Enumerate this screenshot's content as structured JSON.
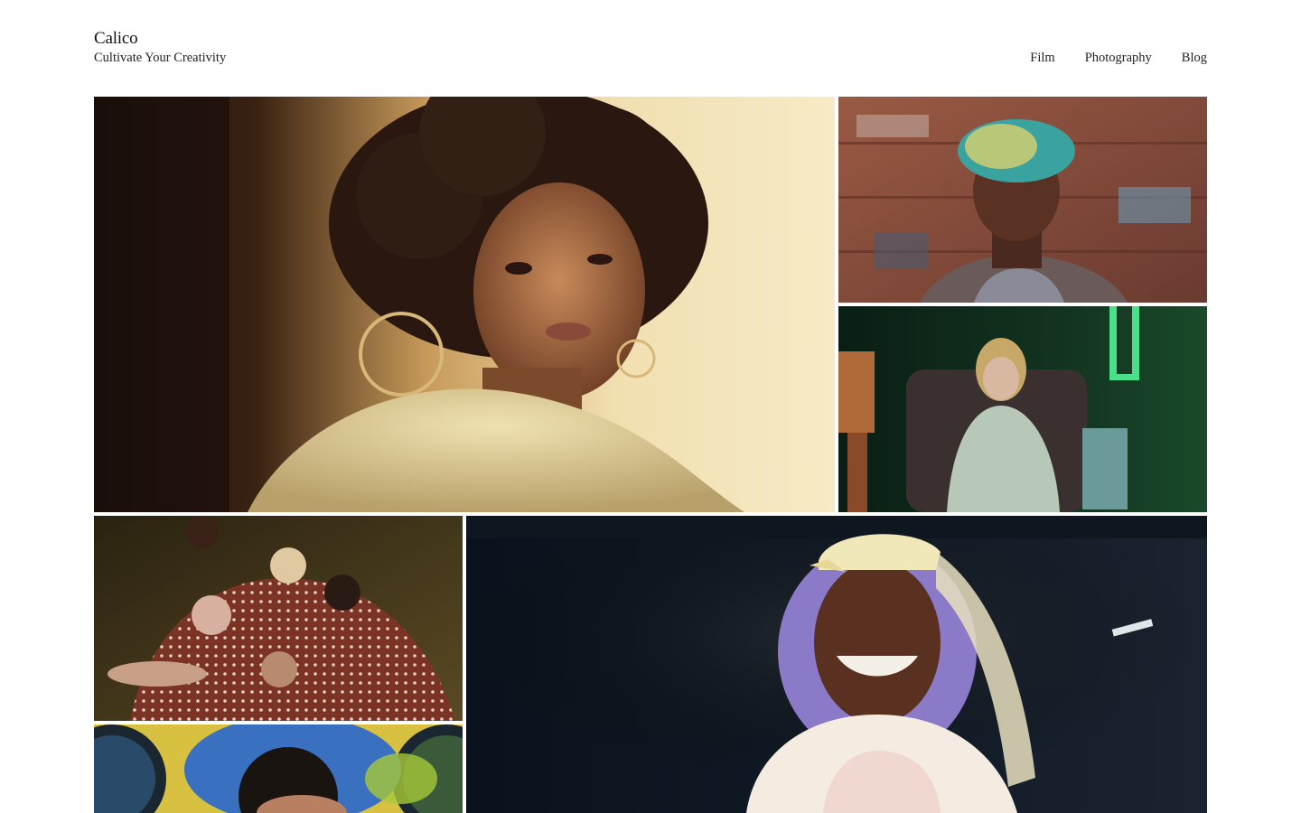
{
  "site": {
    "title": "Calico",
    "tagline": "Cultivate Your Creativity"
  },
  "nav": {
    "items": [
      "Film",
      "Photography",
      "Blog"
    ]
  },
  "gallery": {
    "tiles": [
      {
        "subject": "portrait-woman-hoop-earring",
        "palette": [
          "#2a1a12",
          "#f3e2b8",
          "#d9c08a"
        ]
      },
      {
        "subject": "portrait-man-teal-hair-graffiti",
        "palette": [
          "#8a4a38",
          "#3fa3a0",
          "#5c4a46"
        ]
      },
      {
        "subject": "woman-in-armchair-green-neon",
        "palette": [
          "#0f2a1a",
          "#1f8a4a",
          "#b8c9b8"
        ]
      },
      {
        "subject": "group-polka-dot-dresses",
        "palette": [
          "#3a2f1a",
          "#7a3a28",
          "#d8b8a0"
        ]
      },
      {
        "subject": "smiling-woman-purple-hair-cap",
        "palette": [
          "#0a1420",
          "#e8d8a8",
          "#8a7ac8"
        ]
      },
      {
        "subject": "woman-curly-hair-laundromat",
        "palette": [
          "#d8c040",
          "#3a70c0",
          "#1a1a1a"
        ]
      }
    ]
  }
}
